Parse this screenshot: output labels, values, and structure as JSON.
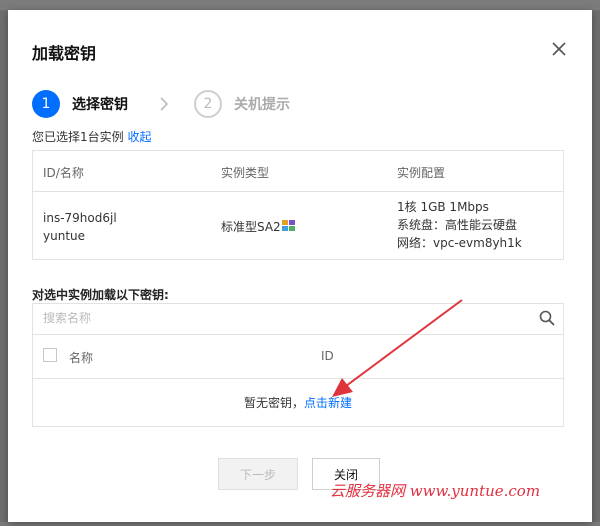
{
  "dialog": {
    "title": "加载密钥",
    "steps": [
      {
        "number": "1",
        "label": "选择密钥"
      },
      {
        "number": "2",
        "label": "关机提示"
      }
    ],
    "selected_text": "您已选择1台实例",
    "collapse_link": "收起",
    "instance_table": {
      "headers": [
        "ID/名称",
        "实例类型",
        "实例配置"
      ],
      "rows": [
        {
          "id": "ins-79hod6jl",
          "name": "yuntue",
          "type": "标准型SA2",
          "config": [
            "1核 1GB 1Mbps",
            "系统盘：高性能云硬盘",
            "网络：vpc-evm8yh1k"
          ]
        }
      ]
    },
    "key_section": {
      "label": "对选中实例加载以下密钥:",
      "search_placeholder": "搜索名称",
      "headers": [
        "名称",
        "ID"
      ],
      "empty_text": "暂无密钥，",
      "create_link": "点击新建"
    },
    "buttons": {
      "next": "下一步",
      "close": "关闭"
    }
  },
  "watermark": "云服务器网 www.yuntue.com",
  "colors": {
    "accent": "#006eff",
    "watermark": "#e03040",
    "annotation_arrow": "#e0343c"
  },
  "icons": [
    "close-icon",
    "chevron-right-icon",
    "search-icon",
    "sa2-badge-icon"
  ]
}
